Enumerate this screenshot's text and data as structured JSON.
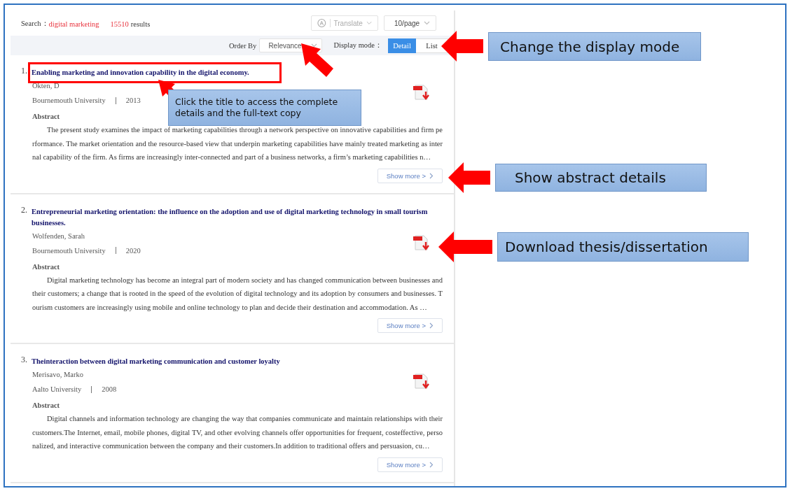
{
  "search": {
    "label": "Search：",
    "query": "digital marketing",
    "count": "15510",
    "count_suffix": "results"
  },
  "translate_button": "Translate",
  "page_size": "10/page",
  "order_by": {
    "label": "Order By",
    "value": "Relevance"
  },
  "display_mode": {
    "label": "Display mode：",
    "options": [
      {
        "label": "Detail",
        "selected": true
      },
      {
        "label": "List",
        "selected": false
      }
    ]
  },
  "results": [
    {
      "number": "1.",
      "title": "Enabling marketing and innovation capability in the digital economy.",
      "author": "Okten, D",
      "university": "Bournemouth University",
      "year": "2013",
      "abstract_label": "Abstract",
      "abstract": "The present study examines the impact of marketing capabilities through a network perspective on innovative capabilities and firm performance. The market orientation and the resource-based view that underpin marketing capabilities have mainly treated marketing as internal capability of the firm. As firms are increasingly inter-connected and part of a business networks, a firm’s marketing capabilities n…",
      "show_more": "Show more >"
    },
    {
      "number": "2.",
      "title": "Entrepreneurial marketing orientation: the influence on the adoption and use of digital marketing technology in small tourism businesses.",
      "author": "Wolfenden, Sarah",
      "university": "Bournemouth University",
      "year": "2020",
      "abstract_label": "Abstract",
      "abstract": "Digital marketing technology has become an integral part of modern society and has changed communication between businesses and their customers; a change that is rooted in the speed of the evolution of digital technology and its adoption by consumers and businesses. Tourism customers are increasingly using mobile and online technology to plan and decide their destination and accommodation. As …",
      "show_more": "Show more >"
    },
    {
      "number": "3.",
      "title": "Theinteraction between digital marketing communication and customer loyalty",
      "author": "Merisavo, Marko",
      "university": "Aalto University",
      "year": "2008",
      "abstract_label": "Abstract",
      "abstract": "Digital channels and information technology are changing the way that companies communicate and maintain relationships with their customers.The Internet, email, mobile phones, digital TV, and other evolving channels offer opportunities for frequent, costeffective, personalized, and interactive communication between the company and their customers.In addition to traditional offers and persuasion, cu…",
      "show_more": "Show more >"
    }
  ],
  "annotations": [
    {
      "kind": "title",
      "text": "Click the title to access the complete details and the full-text copy"
    },
    {
      "kind": "display",
      "text": "Change the display mode"
    },
    {
      "kind": "abstract",
      "text": "Show abstract details"
    },
    {
      "kind": "download",
      "text": "Download thesis/dissertation"
    }
  ]
}
